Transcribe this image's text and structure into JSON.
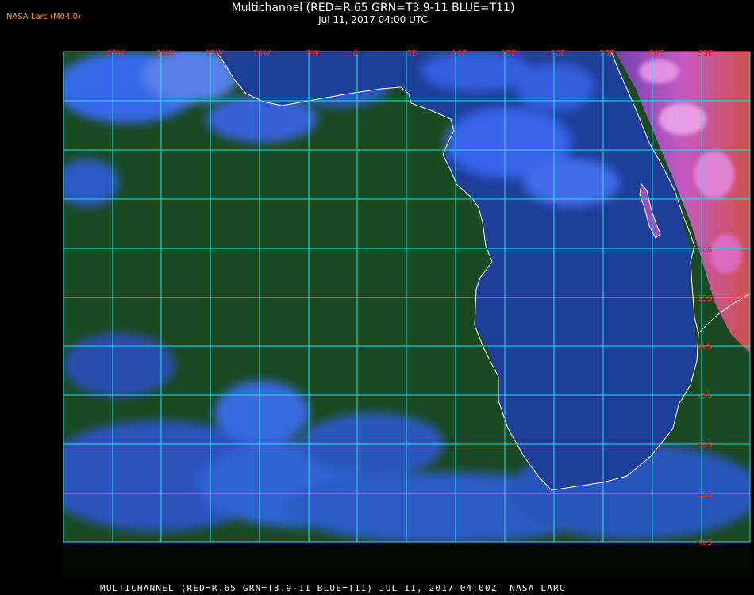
{
  "header": {
    "badge": "NASA Larc (M04.0)",
    "title": "Multichannel (RED=R.65 GRN=T3.9-11 BLUE=T11)",
    "subtitle": "Jul 11, 2017 04:00 UTC"
  },
  "footer": {
    "caption": "MULTICHANNEL (RED=R.65 GRN=T3.9-11 BLUE=T11) JUL 11, 2017 04:00Z  NASA LARC"
  },
  "map": {
    "longitude_labels": [
      "25W",
      "20W",
      "15W",
      "10W",
      "5W",
      "0",
      "5E",
      "10E",
      "15E",
      "20E",
      "25E",
      "30E",
      "35E"
    ],
    "latitude_labels": [
      "10S",
      "15S",
      "20S",
      "25S",
      "30S",
      "35S",
      "40S"
    ],
    "colors": {
      "grid": "#22ddee",
      "coastline": "#ffffff",
      "label": "#ff2020",
      "land": "#1d3f9a",
      "ocean": "#1a4a22",
      "cloud": "#3a6cff",
      "sunlit": "#d45cd0"
    }
  }
}
